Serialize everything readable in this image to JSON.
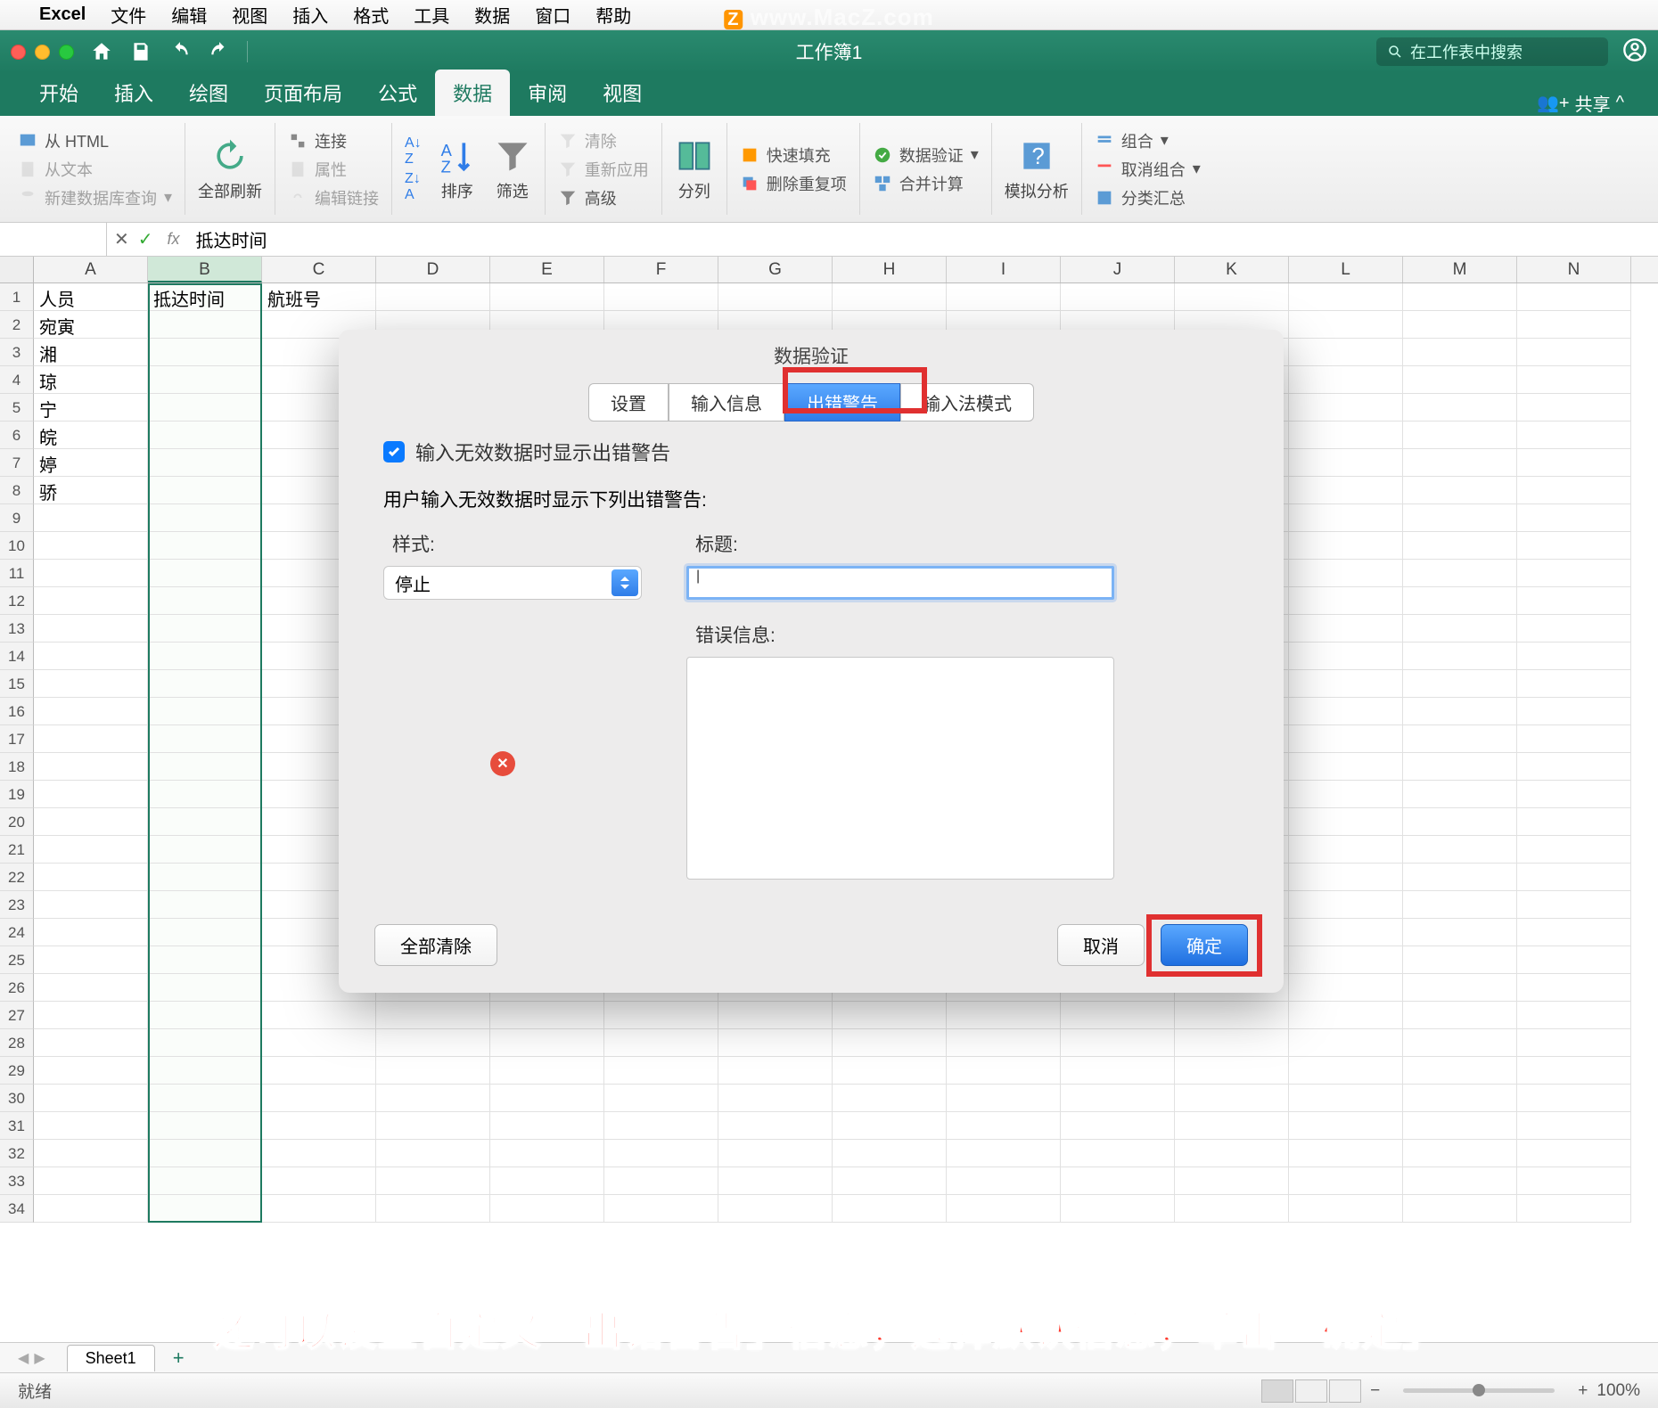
{
  "mac_menu": {
    "app": "Excel",
    "items": [
      "文件",
      "编辑",
      "视图",
      "插入",
      "格式",
      "工具",
      "数据",
      "窗口",
      "帮助"
    ]
  },
  "watermark": "www.MacZ.com",
  "titlebar": {
    "doc": "工作簿1",
    "search_placeholder": "在工作表中搜索"
  },
  "ribbon_tabs": [
    "开始",
    "插入",
    "绘图",
    "页面布局",
    "公式",
    "数据",
    "审阅",
    "视图"
  ],
  "ribbon_active": "数据",
  "share": "共享",
  "ribbon": {
    "g1": {
      "html": "从 HTML",
      "text": "从文本",
      "newq": "新建数据库查询"
    },
    "g2": {
      "refresh": "全部刷新"
    },
    "g3": {
      "connect": "连接",
      "prop": "属性",
      "editlink": "编辑链接"
    },
    "g4": {
      "sort": "排序",
      "filter": "筛选"
    },
    "g5": {
      "clear": "清除",
      "reapply": "重新应用",
      "advanced": "高级"
    },
    "g6": {
      "split": "分列"
    },
    "g7": {
      "flash": "快速填充",
      "dedup": "删除重复项"
    },
    "g8": {
      "valid": "数据验证",
      "consol": "合并计算"
    },
    "g9": {
      "whatif": "模拟分析"
    },
    "g10": {
      "group": "组合",
      "ungroup": "取消组合",
      "subtotal": "分类汇总"
    }
  },
  "formula": {
    "value": "抵达时间"
  },
  "columns": [
    "A",
    "B",
    "C",
    "D",
    "E",
    "F",
    "G",
    "H",
    "I",
    "J",
    "K",
    "L",
    "M",
    "N"
  ],
  "rows_count": 34,
  "data_rows": [
    [
      "人员",
      "抵达时间",
      "航班号"
    ],
    [
      "宛寅",
      "",
      ""
    ],
    [
      "湘",
      "",
      ""
    ],
    [
      "琼",
      "",
      ""
    ],
    [
      "宁",
      "",
      ""
    ],
    [
      "皖",
      "",
      ""
    ],
    [
      "婷",
      "",
      ""
    ],
    [
      "骄",
      "",
      ""
    ]
  ],
  "dialog": {
    "title": "数据验证",
    "tabs": [
      "设置",
      "输入信息",
      "出错警告",
      "输入法模式"
    ],
    "active_tab": "出错警告",
    "checkbox": "输入无效数据时显示出错警告",
    "subtitle": "用户输入无效数据时显示下列出错警告:",
    "style_label": "样式:",
    "style_value": "停止",
    "title_label": "标题:",
    "error_label": "错误信息:",
    "clear": "全部清除",
    "cancel": "取消",
    "ok": "确定"
  },
  "annotation": "还可以设置自定义「出错警告」信息，选择默认信息，单击「确定」",
  "status": {
    "ready": "就绪",
    "zoom": "100%"
  },
  "sheet_tabs": {
    "s1": "Sheet1"
  }
}
